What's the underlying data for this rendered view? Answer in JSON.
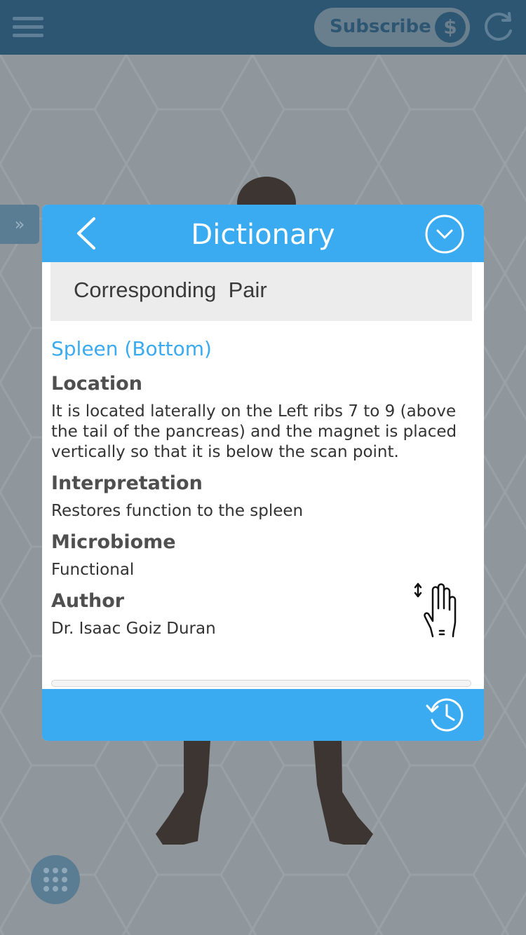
{
  "topbar": {
    "menu_icon": "hamburger-icon",
    "subscribe_label": "Subscribe",
    "subscribe_icon": "dollar-icon",
    "dollar_symbol": "$",
    "refresh_icon": "refresh-icon"
  },
  "side_tab": {
    "icon": "double-chevron-right-icon",
    "glyph": "»"
  },
  "grid_button": {
    "icon": "grid-dots-icon"
  },
  "dialog": {
    "title": "Dictionary",
    "back_icon": "chevron-left-icon",
    "collapse_icon": "chevron-down-circle-icon",
    "section": "Corresponding  Pair",
    "entry": {
      "title": "Spleen (Bottom)",
      "fields": [
        {
          "label": "Location",
          "value": "It is located laterally on the Left ribs 7 to 9 (above the tail of the pancreas) and the magnet is placed vertically so that it is below the scan point."
        },
        {
          "label": "Interpretation",
          "value": "Restores function to the spleen"
        },
        {
          "label": "Microbiome",
          "value": "Functional"
        },
        {
          "label": "Author",
          "value": "Dr. Isaac Goiz Duran"
        }
      ]
    },
    "gesture_icon": "scroll-gesture-hand-icon",
    "footer_icon": "history-icon"
  },
  "colors": {
    "accent": "#3aabf0",
    "topbar": "#2d5672",
    "overlay": "#8f979c"
  }
}
